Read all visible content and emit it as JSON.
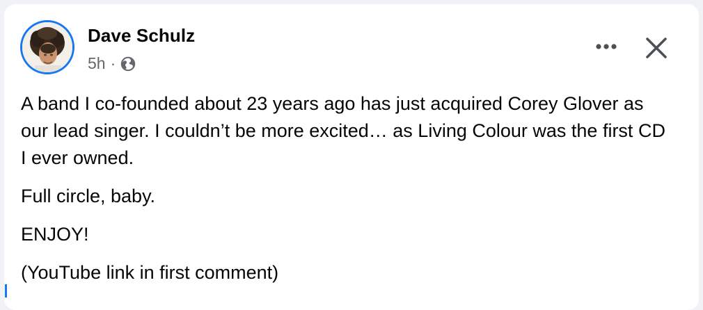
{
  "post": {
    "author": {
      "name": "Dave Schulz",
      "avatar_icon": "profile-photo-avatar"
    },
    "timestamp": "5h",
    "separator": "·",
    "audience_icon": "globe-icon",
    "paragraphs": [
      "A band I co-founded about 23 years ago has just acquired Corey Glover as our lead singer.  I couldn’t be more excited… as Living Colour was the first CD I ever owned.",
      "Full circle, baby.",
      "ENJOY!",
      "(YouTube link in first comment)"
    ]
  },
  "actions": {
    "more_icon": "more-options-icon",
    "close_icon": "close-icon"
  },
  "colors": {
    "accent": "#1877f2",
    "text_primary": "#050505",
    "text_secondary": "#65676b",
    "page_background": "#f0f2f5",
    "card_background": "#ffffff"
  }
}
